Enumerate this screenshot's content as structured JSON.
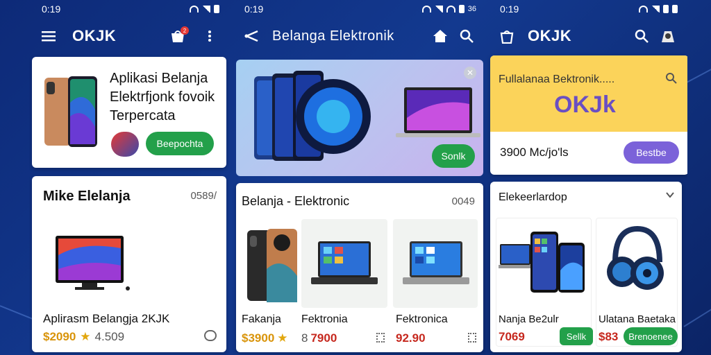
{
  "phones": [
    {
      "status_time": "0:19",
      "appbar_title": "OKJK",
      "notif_count": "2",
      "hero": {
        "title": "Aplikasi Belanja Elektrfjonk fovoik Terpercata",
        "button": "Beepochta"
      },
      "section": {
        "title": "Mike Elelanja",
        "count": "0589/",
        "product_name": "Aplirasm Belangja 2KJK",
        "price": "$2090",
        "star": "★",
        "old_price": "4.509"
      }
    },
    {
      "status_time": "0:19",
      "appbar_title": "Belanga Elektronik",
      "status_right": "36",
      "banner": {
        "button": "Sonlk"
      },
      "section": {
        "title": "Belanja - Elektronic",
        "count": "0049",
        "items": [
          {
            "name": "Fakanja",
            "price": "$3900",
            "star": "★"
          },
          {
            "name": "Fektronia",
            "price": "7900",
            "rating": "8"
          },
          {
            "name": "Fektronica",
            "price": "92.90"
          }
        ]
      }
    },
    {
      "status_time": "0:19",
      "appbar_title": "OKJK",
      "search_banner": {
        "placeholder": "Fullalanaa Bektronik.....",
        "brand": "OKJk"
      },
      "promo": {
        "text": "3900 Mc/jo'ls",
        "button": "Bestbe"
      },
      "section": {
        "title": "Elekeerlardop",
        "items": [
          {
            "name": "Nanja Be2ulr",
            "price": "7069",
            "button": "Sellk"
          },
          {
            "name": "Ulatana Baetaka",
            "price": "$83",
            "button": "Brenoenee"
          }
        ]
      }
    }
  ],
  "colors": {
    "app_bar": "#11358c",
    "accent_green": "#23a04a",
    "accent_purple": "#7b62d9",
    "price_red": "#c6281e",
    "banner_yellow": "#fbd35a"
  }
}
